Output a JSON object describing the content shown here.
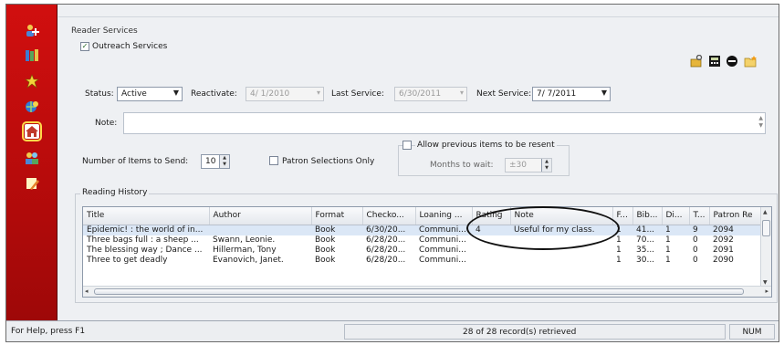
{
  "reader_services": {
    "section_label": "Reader Services",
    "outreach_label": "Outreach Services",
    "outreach_checked": true
  },
  "toolbar_icons": [
    "key-lock-icon",
    "calculator-icon",
    "no-entry-icon",
    "folder-star-icon"
  ],
  "sidebar_icons": [
    "patron-add-icon",
    "books-icon",
    "star-burst-icon",
    "globe-search-icon",
    "home-icon",
    "people-icon",
    "pencil-note-icon"
  ],
  "status": {
    "status_label": "Status:",
    "status_value": "Active",
    "reactivate_label": "Reactivate:",
    "reactivate_value": "4/ 1/2010",
    "last_service_label": "Last Service:",
    "last_service_value": "6/30/2011",
    "next_service_label": "Next Service:",
    "next_service_value": "7/ 7/2011"
  },
  "note": {
    "label": "Note:",
    "value": ""
  },
  "items": {
    "label": "Number of Items to Send:",
    "value": "10",
    "patron_selections_label": "Patron Selections Only",
    "allow_previous_label": "Allow previous items to be resent",
    "months_label": "Months to wait:",
    "months_value": "±30"
  },
  "history": {
    "label": "Reading History",
    "columns": [
      "Title",
      "Author",
      "Format",
      "Checko...",
      "Loaning ...",
      "Rating",
      "Note",
      "F...",
      "Bib...",
      "Di...",
      "T...",
      "Patron Re"
    ],
    "rows": [
      [
        "Epidemic! : the world of in...",
        "",
        "Book",
        "6/30/20...",
        "Communi...",
        "4",
        "Useful for my class.",
        "1",
        "41...",
        "1",
        "9",
        "2094"
      ],
      [
        "Three bags full : a sheep ...",
        "Swann, Leonie.",
        "Book",
        "6/28/20...",
        "Communi...",
        "",
        "",
        "1",
        "70...",
        "1",
        "0",
        "2092"
      ],
      [
        "The blessing way ; Dance ...",
        "Hillerman, Tony",
        "Book",
        "6/28/20...",
        "Communi...",
        "",
        "",
        "1",
        "35...",
        "1",
        "0",
        "2091"
      ],
      [
        "Three to get deadly",
        "Evanovich, Janet.",
        "Book",
        "6/28/20...",
        "Communi...",
        "",
        "",
        "1",
        "30...",
        "1",
        "0",
        "2090"
      ]
    ]
  },
  "statusbar": {
    "help": "For Help, press F1",
    "records": "28 of 28 record(s) retrieved",
    "num": "NUM"
  }
}
